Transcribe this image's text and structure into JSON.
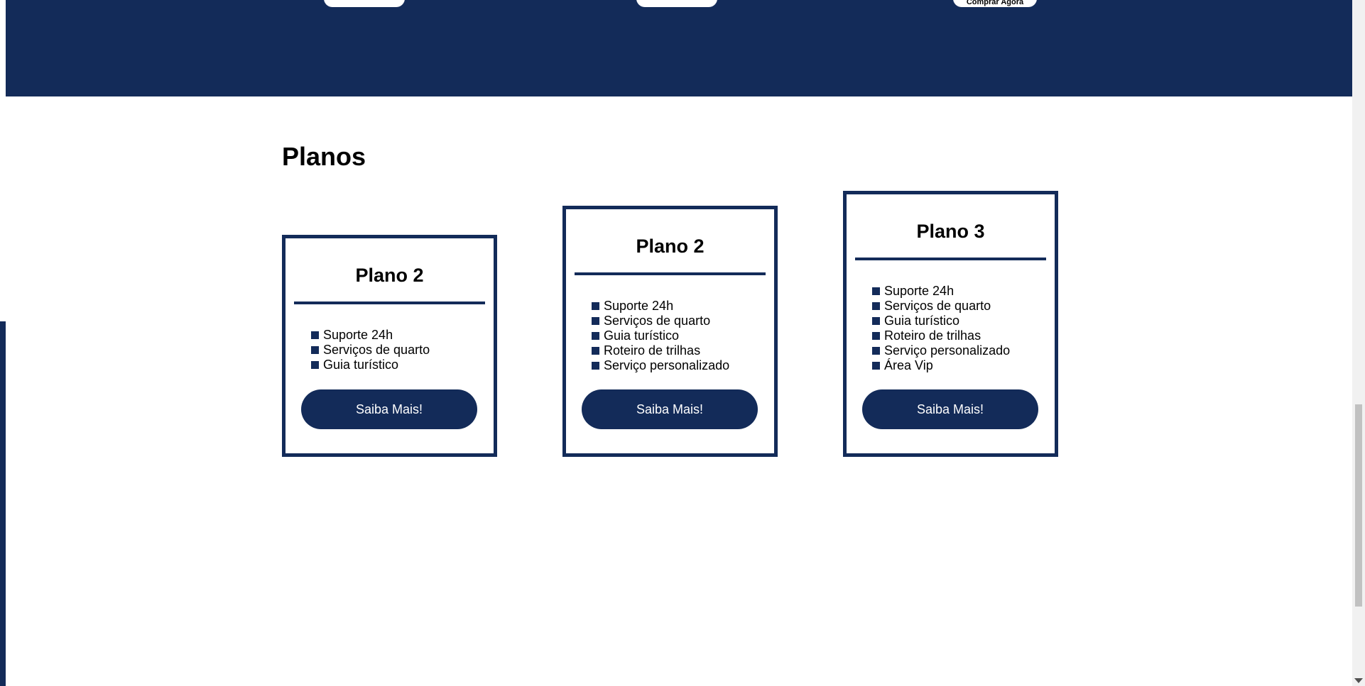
{
  "hero": {
    "buttons": [
      "",
      "",
      "Comprar Agora"
    ]
  },
  "planos": {
    "title": "Planos",
    "cards": [
      {
        "name": "Plano 2",
        "features": [
          "Suporte 24h",
          "Serviços de quarto",
          "Guia turístico"
        ],
        "button": "Saiba Mais!"
      },
      {
        "name": "Plano 2",
        "features": [
          "Suporte 24h",
          "Serviços de quarto",
          "Guia turístico",
          "Roteiro de trilhas",
          "Serviço personalizado"
        ],
        "button": "Saiba Mais!"
      },
      {
        "name": "Plano 3",
        "features": [
          "Suporte 24h",
          "Serviços de quarto",
          "Guia turístico",
          "Roteiro de trilhas",
          "Serviço personalizado",
          "Área Vip"
        ],
        "button": "Saiba Mais!"
      }
    ]
  },
  "colors": {
    "brand": "#132b59",
    "background": "#ffffff"
  }
}
